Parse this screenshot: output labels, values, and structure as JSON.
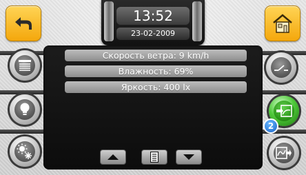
{
  "header": {
    "time": "13:52",
    "date": "23-02-2009"
  },
  "info_lines": [
    {
      "label": "Скорость ветра: 9 km/h"
    },
    {
      "label": "Влажность: 69%"
    },
    {
      "label": "Яркость: 400 lx"
    }
  ],
  "left_buttons": [
    {
      "icon": "blinds-icon"
    },
    {
      "icon": "light-bulb-icon"
    },
    {
      "icon": "sun-snow-icon"
    }
  ],
  "right_buttons": [
    {
      "icon": "switch-icon"
    },
    {
      "icon": "scene-arrow-icon",
      "active": true,
      "badge": "2"
    },
    {
      "icon": "scene-curve-icon"
    }
  ],
  "top_buttons": {
    "back_icon": "back-arrow-icon",
    "home_icon": "home-icon"
  },
  "colors": {
    "accent_yellow": "#f4a70c",
    "active_green": "#3bbf2a",
    "badge_blue": "#1b66c9"
  }
}
